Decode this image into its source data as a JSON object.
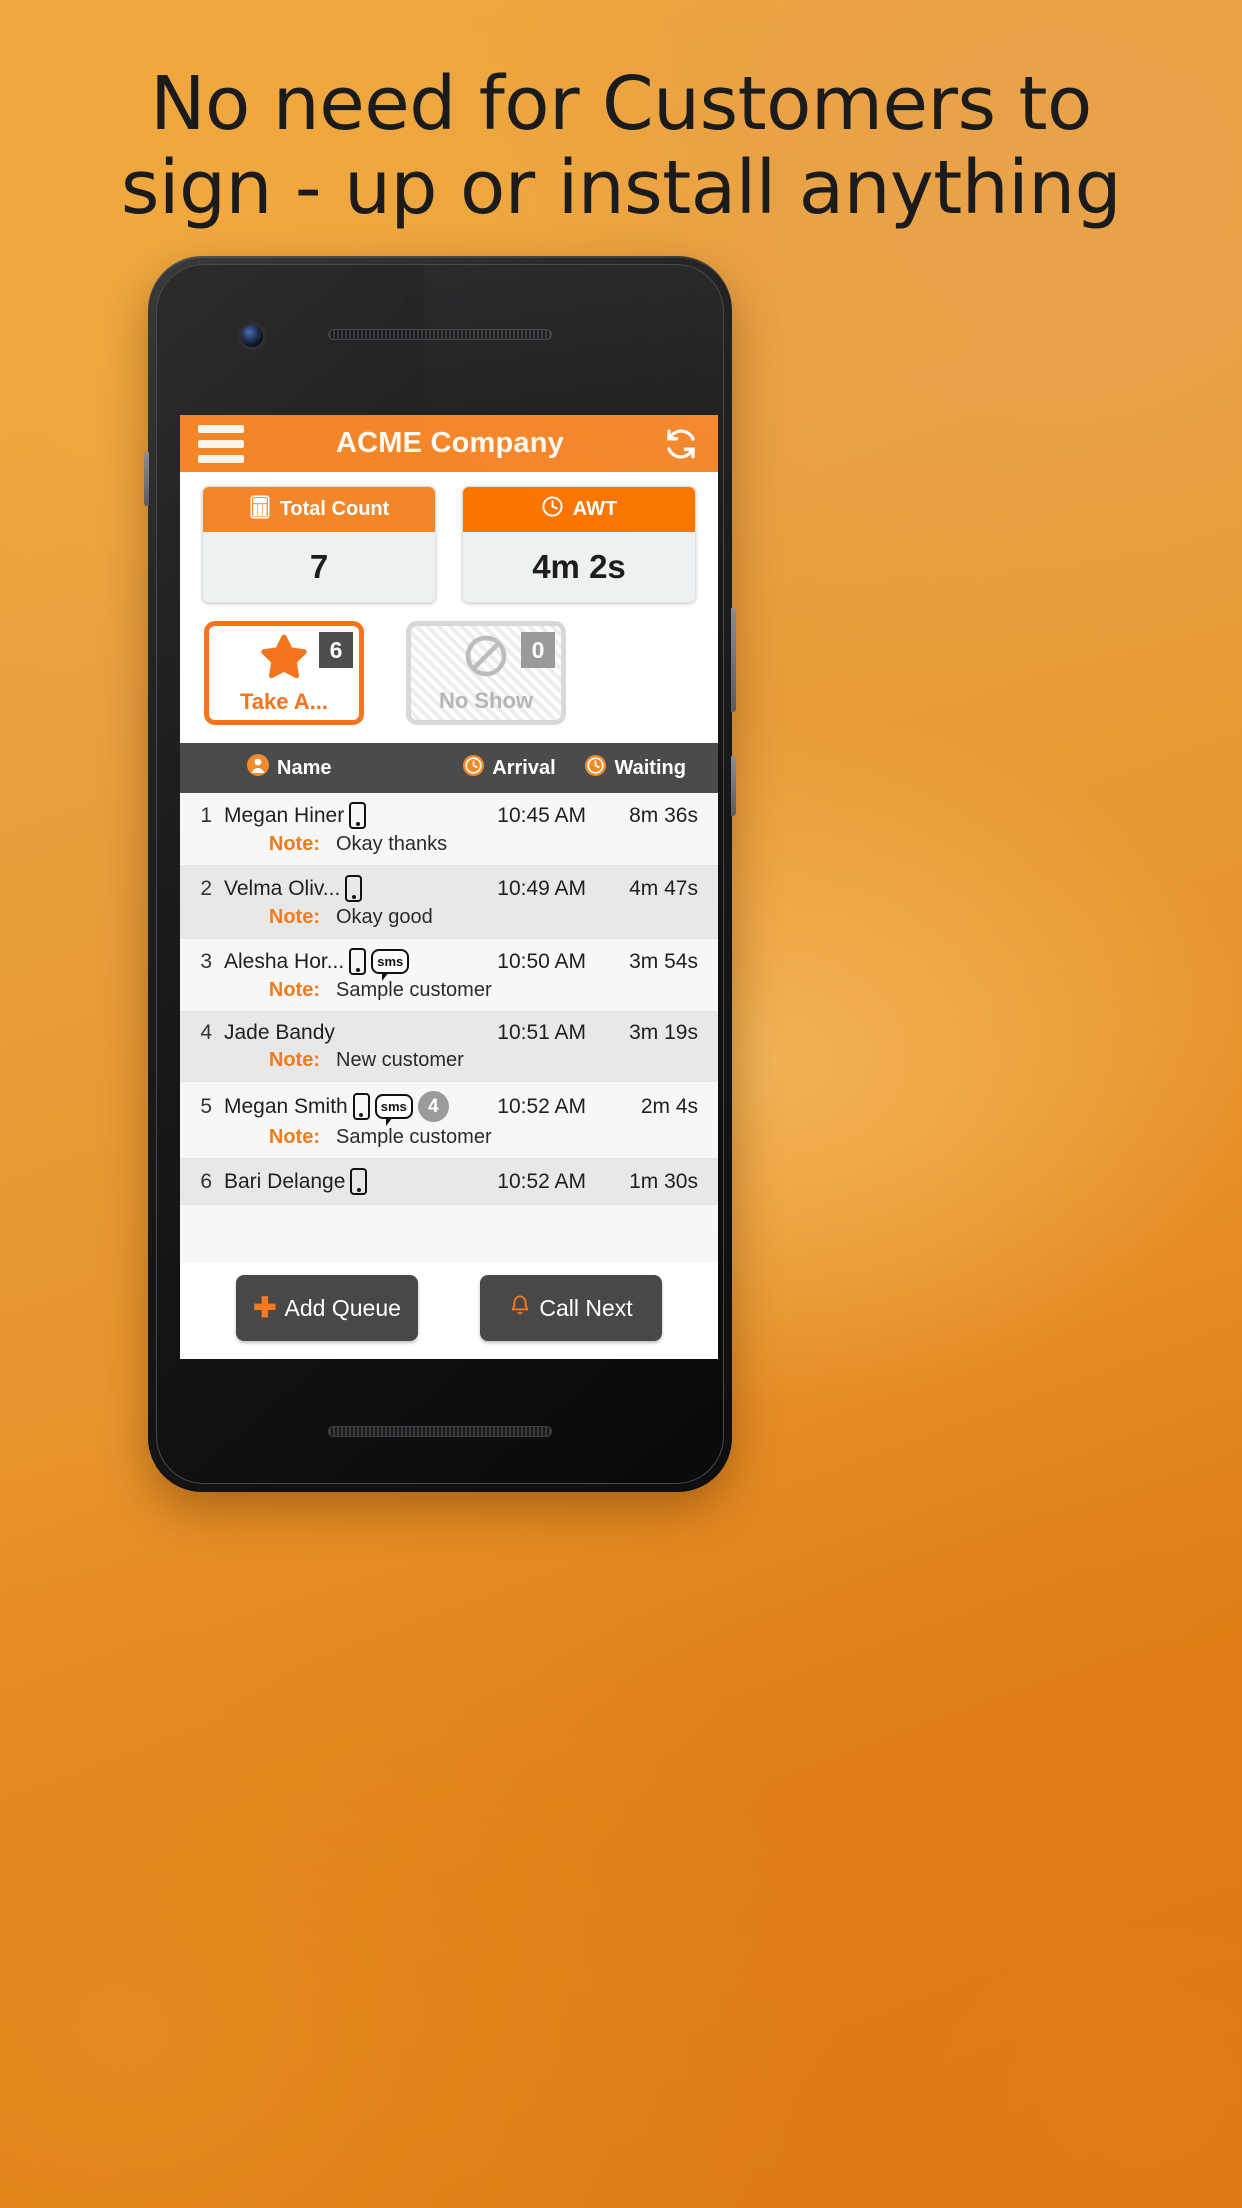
{
  "poster": {
    "headline_line1": "No need for Customers to",
    "headline_line2": "sign - up or install anything",
    "background_color": "#e8952c",
    "accent_color": "#f4862a"
  },
  "app": {
    "appbar": {
      "menu_icon": "hamburger-menu-icon",
      "title": "ACME Company",
      "refresh_icon": "refresh-icon"
    },
    "stats": [
      {
        "icon": "calculator-icon",
        "label": "Total Count",
        "value": "7"
      },
      {
        "icon": "clock-icon",
        "label": "AWT",
        "value": "4m 2s"
      }
    ],
    "tiles": [
      {
        "icon": "star-icon",
        "label": "Take A...",
        "badge": "6",
        "state": "active"
      },
      {
        "icon": "no-entry-icon",
        "label": "No Show",
        "badge": "0",
        "state": "disabled"
      }
    ],
    "table": {
      "columns": [
        {
          "icon": "person-icon",
          "label": "Name"
        },
        {
          "icon": "clock-icon",
          "label": "Arrival"
        },
        {
          "icon": "clock-icon",
          "label": "Waiting"
        }
      ],
      "note_label": "Note:",
      "rows": [
        {
          "index": "1",
          "name": "Megan Hiner",
          "phone": true,
          "sms": false,
          "count": "",
          "arrival": "10:45 AM",
          "waiting": "8m 36s",
          "note": "Okay thanks"
        },
        {
          "index": "2",
          "name": "Velma Oliv...",
          "phone": true,
          "sms": false,
          "count": "",
          "arrival": "10:49 AM",
          "waiting": "4m 47s",
          "note": "Okay good"
        },
        {
          "index": "3",
          "name": "Alesha Hor...",
          "phone": true,
          "sms": true,
          "count": "",
          "arrival": "10:50 AM",
          "waiting": "3m 54s",
          "note": "Sample customer"
        },
        {
          "index": "4",
          "name": "Jade Bandy",
          "phone": false,
          "sms": false,
          "count": "",
          "arrival": "10:51 AM",
          "waiting": "3m 19s",
          "note": "New customer"
        },
        {
          "index": "5",
          "name": "Megan Smith",
          "phone": true,
          "sms": true,
          "count": "4",
          "arrival": "10:52 AM",
          "waiting": "2m 4s",
          "note": "Sample customer"
        },
        {
          "index": "6",
          "name": "Bari Delange",
          "phone": true,
          "sms": false,
          "count": "",
          "arrival": "10:52 AM",
          "waiting": "1m 30s",
          "note": ""
        }
      ]
    },
    "bottom": {
      "add_queue_label": "Add Queue",
      "add_queue_icon": "plus-icon",
      "call_next_label": "Call Next",
      "call_next_icon": "bell-icon"
    }
  }
}
